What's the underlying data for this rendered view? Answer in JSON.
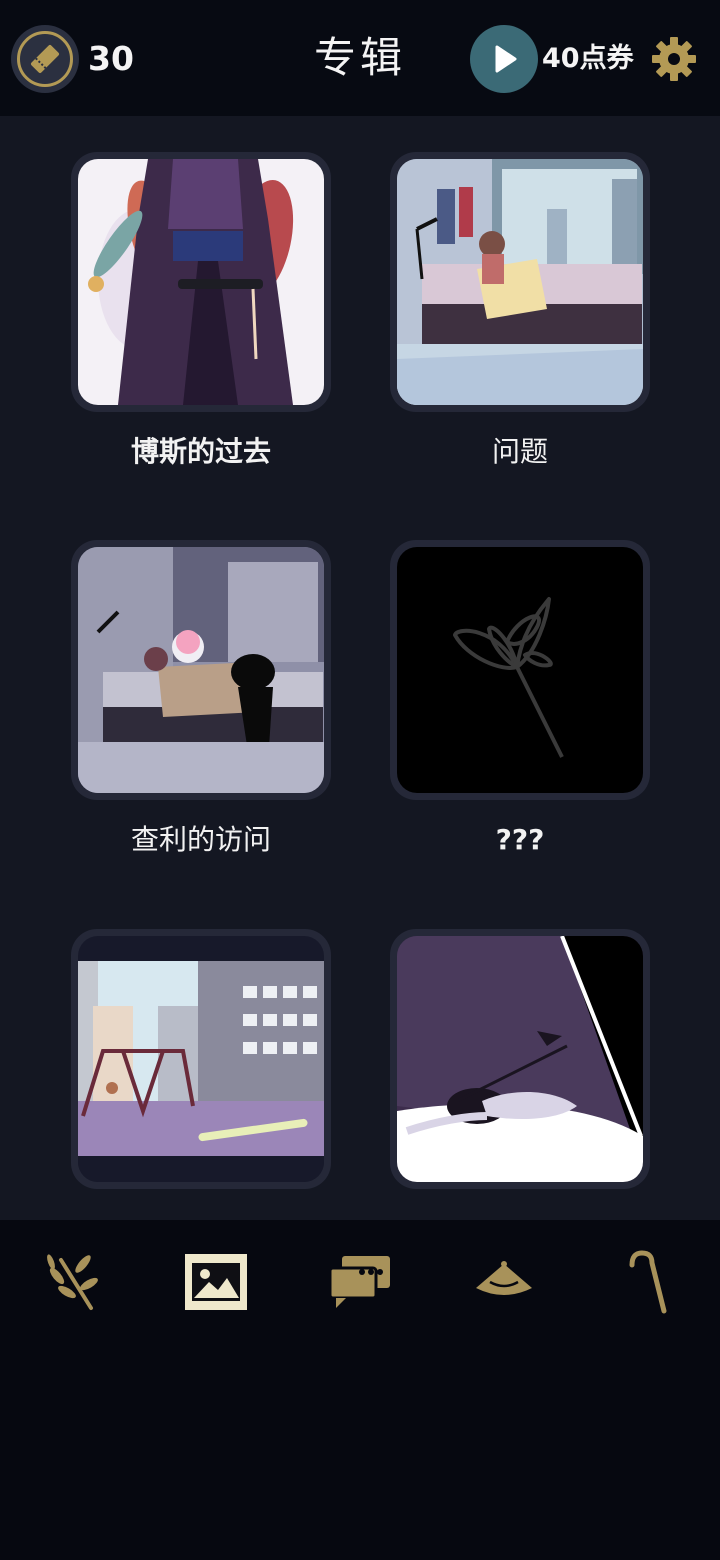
{
  "header": {
    "title": "专辑",
    "ticket_count": "30",
    "points_label": "40点券",
    "icons": {
      "ticket": "ticket-icon",
      "play": "play-icon",
      "settings": "gear-icon"
    }
  },
  "albums": [
    {
      "caption": "博斯的过去",
      "icon": "hooded-figure-image"
    },
    {
      "caption": "问题",
      "icon": "bedroom-image"
    },
    {
      "caption": "查利的访问",
      "icon": "visit-bedroom-image"
    },
    {
      "caption": "???",
      "icon": "locked-flower-image"
    },
    {
      "caption": "",
      "icon": "playground-image"
    },
    {
      "caption": "",
      "icon": "crawling-figure-image"
    }
  ],
  "nav": [
    {
      "icon": "olive-branch-icon",
      "active": false
    },
    {
      "icon": "gallery-icon",
      "active": true
    },
    {
      "icon": "chat-icon",
      "active": false
    },
    {
      "icon": "hat-icon",
      "active": false
    },
    {
      "icon": "cane-icon",
      "active": false
    }
  ],
  "colors": {
    "accent_gold": "#b39a55",
    "play_teal": "#3b6a76",
    "background": "#141722",
    "card": "#252838"
  }
}
